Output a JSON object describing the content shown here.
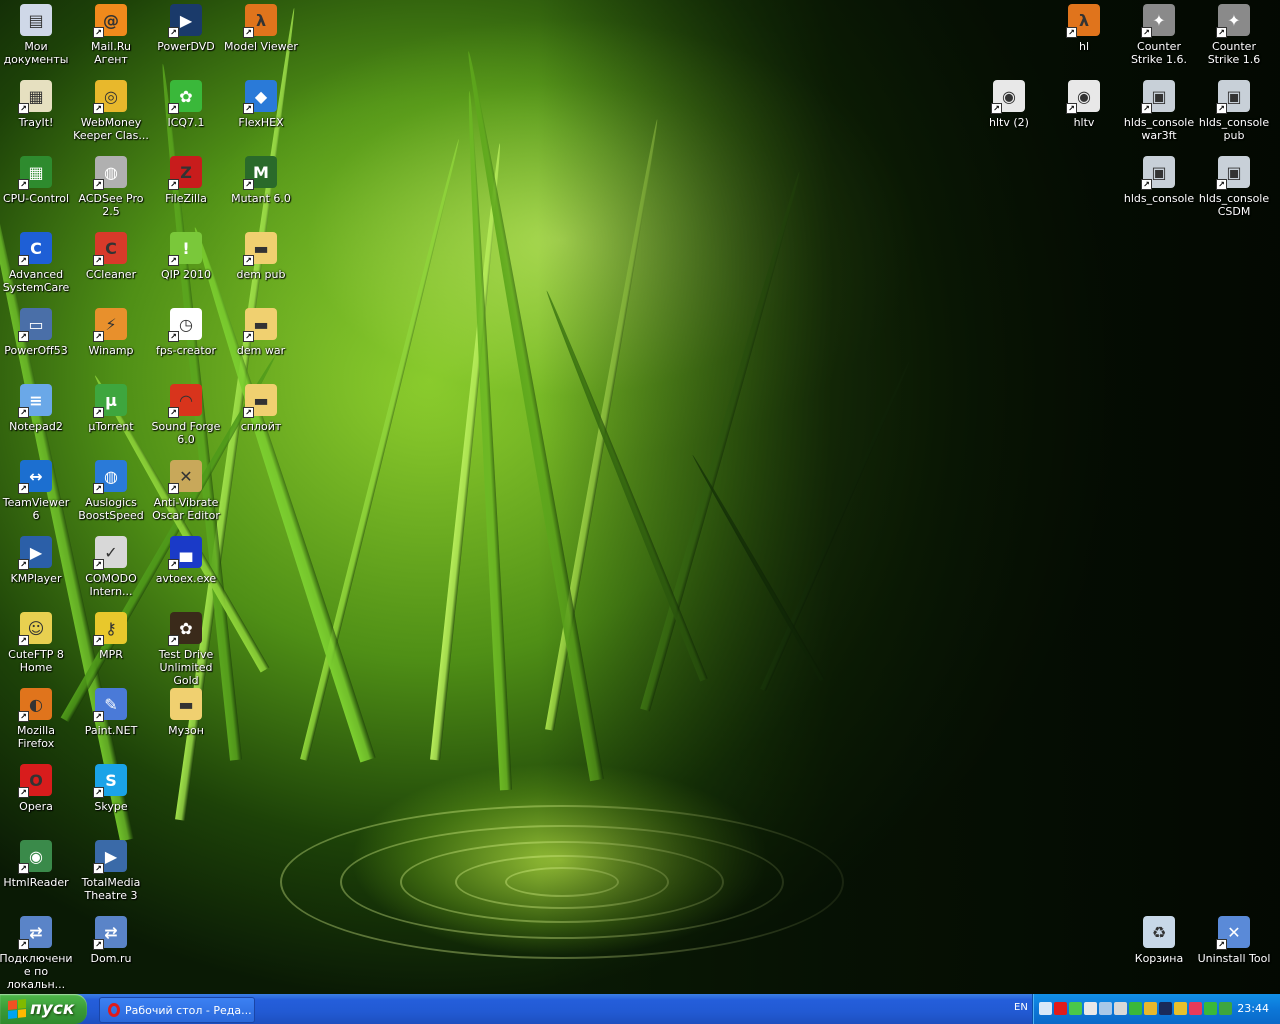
{
  "desktop": {
    "icons": [
      {
        "id": "my-documents",
        "label": "Мои документы",
        "col": 0,
        "row": 0,
        "icon": "folder-docs-icon",
        "color": "#cfd8e8",
        "shortcut": false
      },
      {
        "id": "trayit",
        "label": "TrayIt!",
        "col": 0,
        "row": 1,
        "icon": "trayit-icon",
        "color": "#e6e0c0",
        "shortcut": true
      },
      {
        "id": "cpu-control",
        "label": "CPU-Control",
        "col": 0,
        "row": 2,
        "icon": "chip-icon",
        "color": "#2e8b2e",
        "shortcut": true
      },
      {
        "id": "advanced-systemcare",
        "label": "Advanced SystemCare",
        "col": 0,
        "row": 3,
        "icon": "asc-icon",
        "color": "#1e5fd6",
        "shortcut": true
      },
      {
        "id": "poweroff53",
        "label": "PowerOff53",
        "col": 0,
        "row": 4,
        "icon": "monitor-icon",
        "color": "#4a6fa8",
        "shortcut": true
      },
      {
        "id": "notepad2",
        "label": "Notepad2",
        "col": 0,
        "row": 5,
        "icon": "notepad-icon",
        "color": "#6aa8e8",
        "shortcut": true
      },
      {
        "id": "teamviewer",
        "label": "TeamViewer 6",
        "col": 0,
        "row": 6,
        "icon": "teamviewer-icon",
        "color": "#1c6fd0",
        "shortcut": true
      },
      {
        "id": "kmplayer",
        "label": "KMPlayer",
        "col": 0,
        "row": 7,
        "icon": "kmplayer-icon",
        "color": "#2b5fa8",
        "shortcut": true
      },
      {
        "id": "cuteftp",
        "label": "CuteFTP 8 Home",
        "col": 0,
        "row": 8,
        "icon": "cuteftp-icon",
        "color": "#e8d050",
        "shortcut": true
      },
      {
        "id": "firefox",
        "label": "Mozilla Firefox",
        "col": 0,
        "row": 9,
        "icon": "firefox-icon",
        "color": "#e0741c",
        "shortcut": true
      },
      {
        "id": "opera",
        "label": "Opera",
        "col": 0,
        "row": 10,
        "icon": "opera-icon",
        "color": "#d81c1c",
        "shortcut": true
      },
      {
        "id": "htmlreader",
        "label": "HtmlReader",
        "col": 0,
        "row": 11,
        "icon": "eye-icon",
        "color": "#3a8a4a",
        "shortcut": true
      },
      {
        "id": "local-connection",
        "label": "Подключение по локальн...",
        "col": 0,
        "row": 12,
        "icon": "network-icon",
        "color": "#5a84c8",
        "shortcut": true
      },
      {
        "id": "mailru-agent",
        "label": "Mail.Ru Агент",
        "col": 1,
        "row": 0,
        "icon": "mailru-icon",
        "color": "#f08a1c",
        "shortcut": true
      },
      {
        "id": "webmoney",
        "label": "WebMoney Keeper Clas...",
        "col": 1,
        "row": 1,
        "icon": "webmoney-icon",
        "color": "#e8b82c",
        "shortcut": true
      },
      {
        "id": "acdsee",
        "label": "ACDSee Pro 2.5",
        "col": 1,
        "row": 2,
        "icon": "acdsee-icon",
        "color": "#b0b0b0",
        "shortcut": true
      },
      {
        "id": "ccleaner",
        "label": "CCleaner",
        "col": 1,
        "row": 3,
        "icon": "ccleaner-icon",
        "color": "#d83a2a",
        "shortcut": true
      },
      {
        "id": "winamp",
        "label": "Winamp",
        "col": 1,
        "row": 4,
        "icon": "winamp-icon",
        "color": "#e8902c",
        "shortcut": true
      },
      {
        "id": "utorrent",
        "label": "µTorrent",
        "col": 1,
        "row": 5,
        "icon": "utorrent-icon",
        "color": "#3ea63e",
        "shortcut": true
      },
      {
        "id": "auslogics",
        "label": "Auslogics BoostSpeed",
        "col": 1,
        "row": 6,
        "icon": "globe-icon",
        "color": "#2a7ad8",
        "shortcut": true
      },
      {
        "id": "comodo",
        "label": "COMODO Intern...",
        "col": 1,
        "row": 7,
        "icon": "shield-icon",
        "color": "#d8d8d8",
        "shortcut": true
      },
      {
        "id": "mpr",
        "label": "MPR",
        "col": 1,
        "row": 8,
        "icon": "key-icon",
        "color": "#e8c82c",
        "shortcut": true
      },
      {
        "id": "paintnet",
        "label": "Paint.NET",
        "col": 1,
        "row": 9,
        "icon": "paint-icon",
        "color": "#4a7ad8",
        "shortcut": true
      },
      {
        "id": "skype",
        "label": "Skype",
        "col": 1,
        "row": 10,
        "icon": "skype-icon",
        "color": "#1aa3e8",
        "shortcut": true
      },
      {
        "id": "totalmedia",
        "label": "TotalMedia Theatre 3",
        "col": 1,
        "row": 11,
        "icon": "media-icon",
        "color": "#3a6aa8",
        "shortcut": true
      },
      {
        "id": "domru",
        "label": "Dom.ru",
        "col": 1,
        "row": 12,
        "icon": "network-icon",
        "color": "#5a84c8",
        "shortcut": true
      },
      {
        "id": "powerdvd",
        "label": "PowerDVD",
        "col": 2,
        "row": 0,
        "icon": "dvd-icon",
        "color": "#1a3a6a",
        "shortcut": true
      },
      {
        "id": "icq",
        "label": "ICQ7.1",
        "col": 2,
        "row": 1,
        "icon": "icq-icon",
        "color": "#3ab83a",
        "shortcut": true
      },
      {
        "id": "filezilla",
        "label": "FileZilla",
        "col": 2,
        "row": 2,
        "icon": "filezilla-icon",
        "color": "#c81c1c",
        "shortcut": true
      },
      {
        "id": "qip",
        "label": "QIP 2010",
        "col": 2,
        "row": 3,
        "icon": "qip-icon",
        "color": "#7ac83a",
        "shortcut": true
      },
      {
        "id": "fps-creator",
        "label": "fps-creator",
        "col": 2,
        "row": 4,
        "icon": "clock-icon",
        "color": "#ffffff",
        "shortcut": true
      },
      {
        "id": "sound-forge",
        "label": "Sound Forge 6.0",
        "col": 2,
        "row": 5,
        "icon": "soundforge-icon",
        "color": "#d8341c",
        "shortcut": true
      },
      {
        "id": "anti-vibrate",
        "label": "Anti-Vibrate Oscar Editor",
        "col": 2,
        "row": 6,
        "icon": "cross-icon",
        "color": "#c8a85a",
        "shortcut": true
      },
      {
        "id": "avtoex",
        "label": "avtoex.exe",
        "col": 2,
        "row": 7,
        "icon": "car-icon",
        "color": "#1a3ac8",
        "shortcut": true
      },
      {
        "id": "test-drive",
        "label": "Test Drive Unlimited Gold",
        "col": 2,
        "row": 8,
        "icon": "game-icon",
        "color": "#3a2a1a",
        "shortcut": true
      },
      {
        "id": "muzon",
        "label": "Музон",
        "col": 2,
        "row": 9,
        "icon": "folder-icon",
        "color": "#f0d070",
        "shortcut": false
      },
      {
        "id": "model-viewer",
        "label": "Model Viewer",
        "col": 3,
        "row": 0,
        "icon": "halflife-icon",
        "color": "#e0741c",
        "shortcut": true
      },
      {
        "id": "flexhex",
        "label": "FlexHEX",
        "col": 3,
        "row": 1,
        "icon": "flexhex-icon",
        "color": "#2a7ad8",
        "shortcut": true
      },
      {
        "id": "mutant",
        "label": "Mutant 6.0",
        "col": 3,
        "row": 2,
        "icon": "mutant-icon",
        "color": "#2a6a2a",
        "shortcut": true
      },
      {
        "id": "dem-pub",
        "label": "dem pub",
        "col": 3,
        "row": 3,
        "icon": "folder-icon",
        "color": "#f0d070",
        "shortcut": true
      },
      {
        "id": "dem-war",
        "label": "dem war",
        "col": 3,
        "row": 4,
        "icon": "folder-icon",
        "color": "#f0d070",
        "shortcut": true
      },
      {
        "id": "sploit",
        "label": "сплойт",
        "col": 3,
        "row": 5,
        "icon": "folder-icon",
        "color": "#f0d070",
        "shortcut": true
      },
      {
        "id": "hl",
        "label": "hl",
        "colR": 3,
        "row": 0,
        "icon": "halflife-icon",
        "color": "#e0741c",
        "shortcut": true
      },
      {
        "id": "cs16-a",
        "label": "Counter Strike 1.6.",
        "colR": 2,
        "row": 0,
        "icon": "cs-icon",
        "color": "#8a8a8a",
        "shortcut": true
      },
      {
        "id": "cs16-b",
        "label": "Counter Strike 1.6",
        "colR": 1,
        "row": 0,
        "icon": "cs-icon",
        "color": "#8a8a8a",
        "shortcut": true
      },
      {
        "id": "hltv2",
        "label": "hltv (2)",
        "colR": 4,
        "row": 1,
        "icon": "hltv-icon",
        "color": "#e8e8e8",
        "shortcut": true
      },
      {
        "id": "hltv",
        "label": "hltv",
        "colR": 3,
        "row": 1,
        "icon": "hltv-icon",
        "color": "#e8e8e8",
        "shortcut": true
      },
      {
        "id": "hlds-war3ft",
        "label": "hlds_console war3ft",
        "colR": 2,
        "row": 1,
        "icon": "hlds-icon",
        "color": "#c8d0d8",
        "shortcut": true
      },
      {
        "id": "hlds-pub",
        "label": "hlds_console pub",
        "colR": 1,
        "row": 1,
        "icon": "hlds-icon",
        "color": "#c8d0d8",
        "shortcut": true
      },
      {
        "id": "hlds",
        "label": "hlds_console",
        "colR": 2,
        "row": 2,
        "icon": "hlds-icon",
        "color": "#c8d0d8",
        "shortcut": true
      },
      {
        "id": "hlds-csdm",
        "label": "hlds_console CSDM",
        "colR": 1,
        "row": 2,
        "icon": "hlds-icon",
        "color": "#c8d0d8",
        "shortcut": true
      },
      {
        "id": "recycle-bin",
        "label": "Корзина",
        "colR": 2,
        "row": 12,
        "icon": "recycle-bin-icon",
        "color": "#c8d8e8",
        "shortcut": false
      },
      {
        "id": "uninstall-tool",
        "label": "Uninstall Tool",
        "colR": 1,
        "row": 12,
        "icon": "uninstall-icon",
        "color": "#5a8ad8",
        "shortcut": true
      }
    ]
  },
  "taskbar": {
    "start_label": "пуск",
    "task_item_label": "Рабочий стол - Реда...",
    "language": "EN",
    "clock": "23:44",
    "tray_icons": [
      {
        "name": "back-arrow-icon",
        "color": "#d8e8f8"
      },
      {
        "name": "opera-tray-icon",
        "color": "#e01b1b"
      },
      {
        "name": "check-icon",
        "color": "#4ac84a"
      },
      {
        "name": "volume-icon",
        "color": "#e8e8e8"
      },
      {
        "name": "network-tray-icon",
        "color": "#a8c8e8"
      },
      {
        "name": "usb-icon",
        "color": "#d8d8d8"
      },
      {
        "name": "icq-tray-icon",
        "color": "#3ab83a"
      },
      {
        "name": "webmoney-tray-icon",
        "color": "#e8b82c"
      },
      {
        "name": "monitor-tray-icon",
        "color": "#1a2a5a"
      },
      {
        "name": "shield-tray-icon",
        "color": "#e8c02c"
      },
      {
        "name": "target-icon",
        "color": "#e83a5a"
      },
      {
        "name": "game-tray-icon",
        "color": "#3ab83a"
      },
      {
        "name": "utorrent-tray-icon",
        "color": "#3ea63e"
      }
    ],
    "colors": {
      "start": "#3a9b38",
      "bar": "#245edb",
      "tray": "#0c77d8"
    }
  }
}
